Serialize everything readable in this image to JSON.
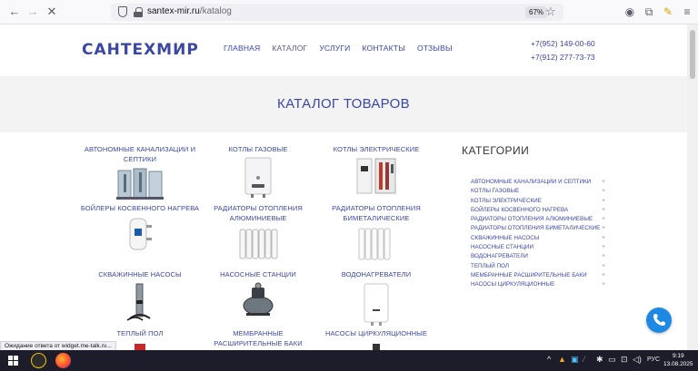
{
  "browser": {
    "url_domain": "santex-mir.ru",
    "url_path": "/katalog",
    "zoom": "67%"
  },
  "site": {
    "logo": "САНТЕХМИР",
    "nav": [
      "ГЛАВНАЯ",
      "КАТАЛОГ",
      "УСЛУГИ",
      "КОНТАКТЫ",
      "ОТЗЫВЫ"
    ],
    "phones": [
      "+7(952) 149-00-60",
      "+7(912) 277-73-73"
    ]
  },
  "hero": {
    "title": "КАТАЛОГ ТОВАРОВ"
  },
  "products": [
    {
      "title": "АВТОНОМНЫЕ КАНАЛИЗАЦИИ И СЕПТИКИ",
      "icon": "septic-tanks-image"
    },
    {
      "title": "КОТЛЫ ГАЗОВЫЕ",
      "icon": "gas-boiler-image"
    },
    {
      "title": "КОТЛЫ ЭЛЕКТРИЧЕСКИЕ",
      "icon": "electric-boiler-image"
    },
    {
      "title": "БОЙЛЕРЫ КОСВЕННОГО НАГРЕВА",
      "icon": "indirect-boiler-image"
    },
    {
      "title": "РАДИАТОРЫ ОТОПЛЕНИЯ АЛЮМИНИЕВЫЕ",
      "icon": "aluminum-radiator-image"
    },
    {
      "title": "РАДИАТОРЫ ОТОПЛЕНИЯ БИМЕТАЛИЧЕСКИЕ",
      "icon": "bimetal-radiator-image"
    },
    {
      "title": "СКВАЖИННЫЕ НАСОСЫ",
      "icon": "borehole-pump-image"
    },
    {
      "title": "НАСОСНЫЕ СТАНЦИИ",
      "icon": "pump-station-image"
    },
    {
      "title": "ВОДОНАГРЕВАТЕЛИ",
      "icon": "water-heater-image"
    },
    {
      "title": "ТЕПЛЫЙ ПОЛ",
      "icon": "warm-floor-image"
    },
    {
      "title": "МЕМБРАННЫЕ РАСШИРИТЕЛЬНЫЕ БАКИ",
      "icon": "expansion-tank-image"
    },
    {
      "title": "НАСОСЫ ЦИРКУЛЯЦИОННЫЕ",
      "icon": "circulation-pump-image"
    }
  ],
  "categories": {
    "heading": "КАТЕГОРИИ",
    "items": [
      "АВТОНОМНЫЕ КАНАЛИЗАЦИИ И СЕПТИКИ",
      "КОТЛЫ ГАЗОВЫЕ",
      "КОТЛЫ ЭЛЕКТРИЧЕСКИЕ",
      "БОЙЛЕРЫ КОСВЕННОГО НАГРЕВА",
      "РАДИАТОРЫ ОТОПЛЕНИЯ АЛЮМИНИЕВЫЕ",
      "РАДИАТОРЫ ОТОПЛЕНИЯ БИМЕТАЛИЧЕСКИЕ",
      "СКВАЖИННЫЕ НАСОСЫ",
      "НАСОСНЫЕ СТАНЦИИ",
      "ВОДОНАГРЕВАТЕЛИ",
      "ТЕПЛЫЙ ПОЛ",
      "МЕМБРАННЫЕ РАСШИРИТЕЛЬНЫЕ БАКИ",
      "НАСОСЫ ЦИРКУЛЯЦИОННЫЕ"
    ],
    "expand_symbol": "+"
  },
  "status_text": "Ожидание ответа от widget.me-talk.ru...",
  "taskbar": {
    "lang": "РУС",
    "time": "9:19",
    "date": "13.08.2025"
  },
  "colors": {
    "brand": "#3a47a5",
    "call": "#1e88e5"
  }
}
